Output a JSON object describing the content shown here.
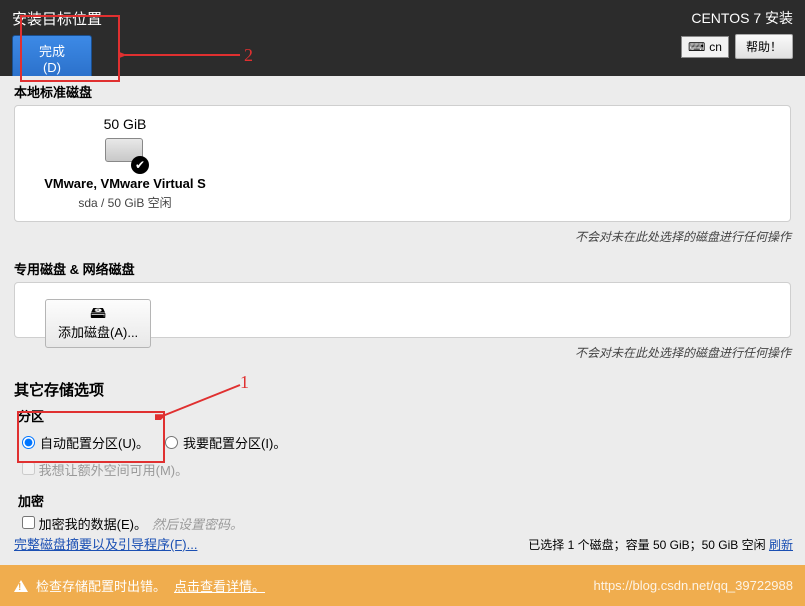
{
  "header": {
    "title": "安装目标位置",
    "done": "完成(D)",
    "installer": "CENTOS 7 安装",
    "keyboard": "cn",
    "help": "帮助！"
  },
  "local": {
    "label": "本地标准磁盘",
    "size": "50 GiB",
    "name": "VMware, VMware Virtual S",
    "sub": "sda   /   50 GiB 空闲",
    "note": "不会对未在此处选择的磁盘进行任何操作"
  },
  "special": {
    "label": "专用磁盘 & 网络磁盘",
    "add": "添加磁盘(A)...",
    "note": "不会对未在此处选择的磁盘进行任何操作"
  },
  "other": {
    "title": "其它存储选项",
    "part_label": "分区",
    "auto": "自动配置分区(U)。",
    "manual": "我要配置分区(I)。",
    "extra": "我想让额外空间可用(M)。",
    "enc_label": "加密",
    "enc_cb": "加密我的数据(E)。",
    "enc_hint": "然后设置密码。"
  },
  "footer": {
    "summary": "完整磁盘摘要以及引导程序(F)...",
    "selected": "已选择 1 个磁盘；容量 50 GiB；50 GiB 空闲 ",
    "refresh": "刷新"
  },
  "warn": {
    "text": "检查存储配置时出错。",
    "link": "点击查看详情。"
  },
  "watermark": "https://blog.csdn.net/qq_39722988",
  "anno": {
    "n1": "1",
    "n2": "2"
  }
}
